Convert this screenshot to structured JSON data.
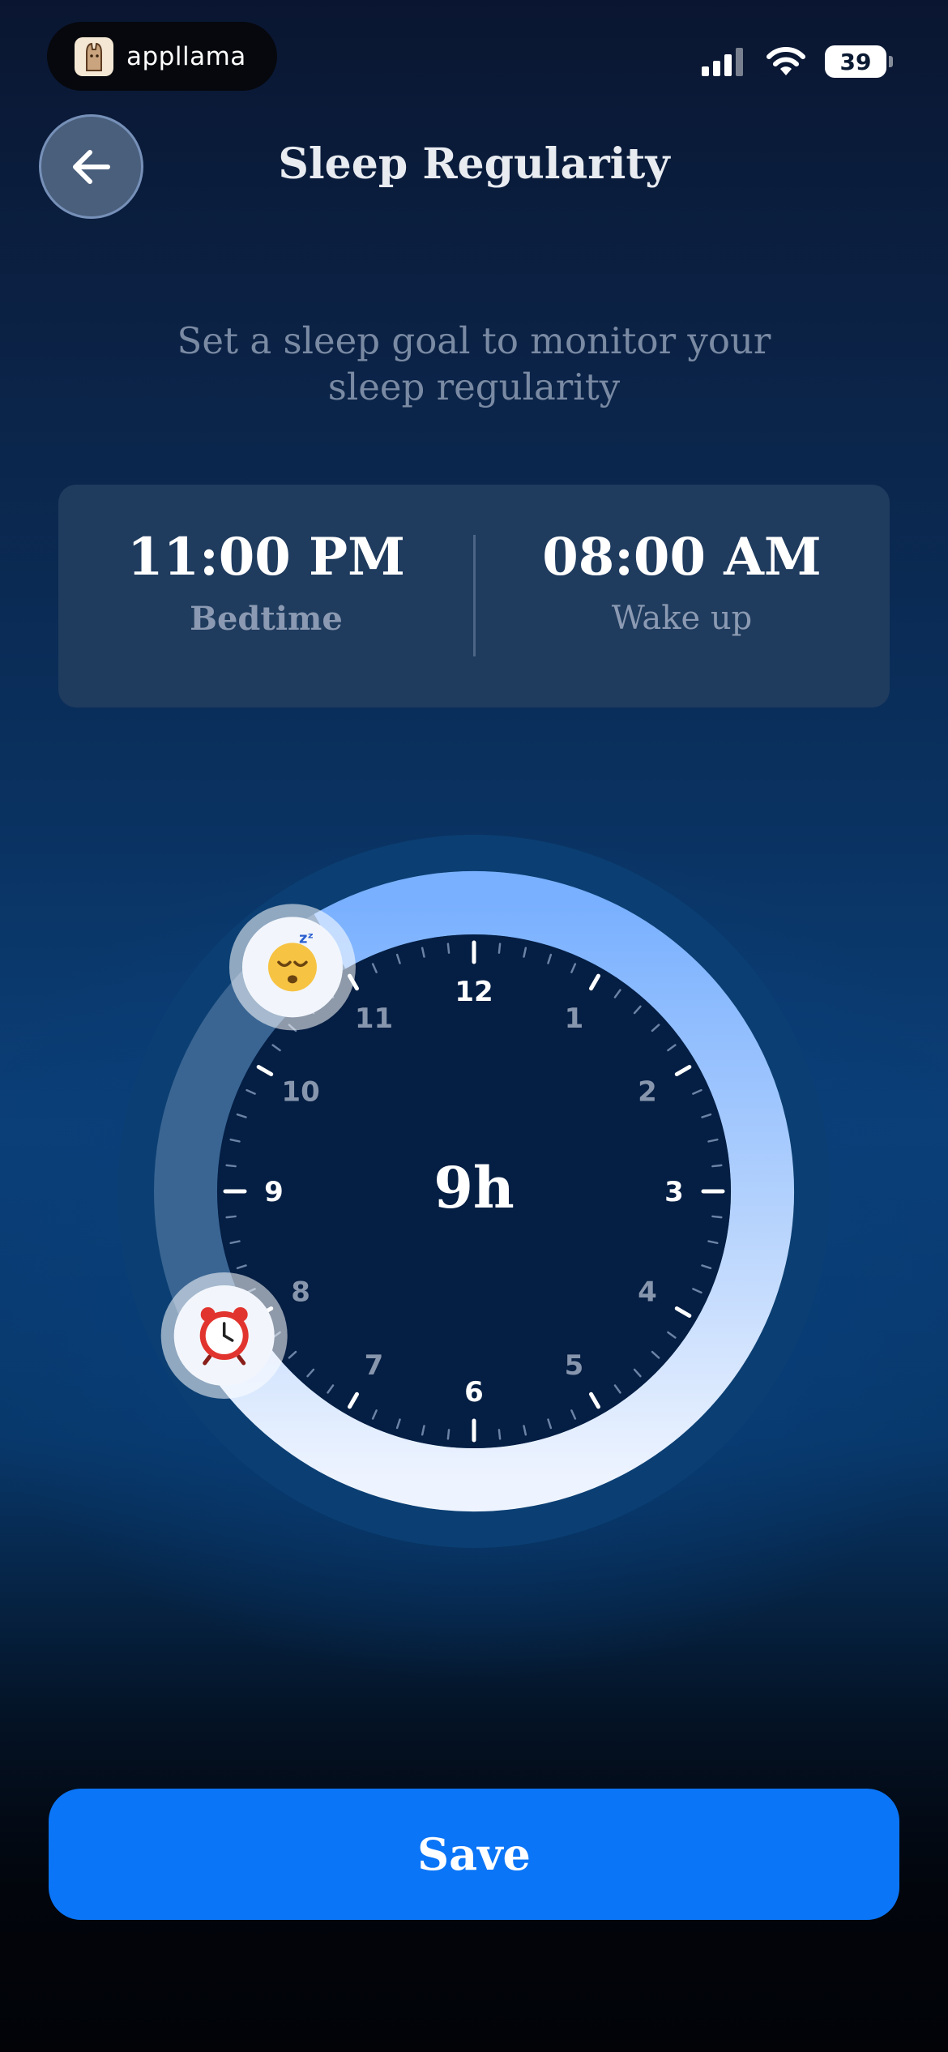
{
  "status_bar": {
    "brand": "appllama",
    "battery": "39",
    "icons": [
      "llama-logo-icon",
      "cellular-signal-icon",
      "wifi-icon",
      "battery-icon"
    ]
  },
  "header": {
    "title": "Sleep Regularity",
    "back_icon": "arrow-left-icon"
  },
  "subtitle": {
    "line1": "Set a sleep goal to monitor your",
    "line2": "sleep regularity"
  },
  "schedule": {
    "bedtime": {
      "value": "11:00 PM",
      "label": "Bedtime"
    },
    "wakeup": {
      "value": "08:00 AM",
      "label": "Wake up"
    }
  },
  "dial": {
    "duration": "9h",
    "bedtime_hour": 23,
    "wakeup_hour": 8,
    "hour_labels": [
      "12",
      "1",
      "2",
      "3",
      "4",
      "5",
      "6",
      "7",
      "8",
      "9",
      "10",
      "11"
    ],
    "bedtime_handle_icon": "sleeping-face-icon",
    "wakeup_handle_icon": "alarm-clock-icon",
    "colors": {
      "arc_start": "#7ab2ff",
      "arc_end": "#eef4ff",
      "face": "#051e43"
    }
  },
  "footer": {
    "save_label": "Save",
    "accent": "#0b75f7"
  }
}
